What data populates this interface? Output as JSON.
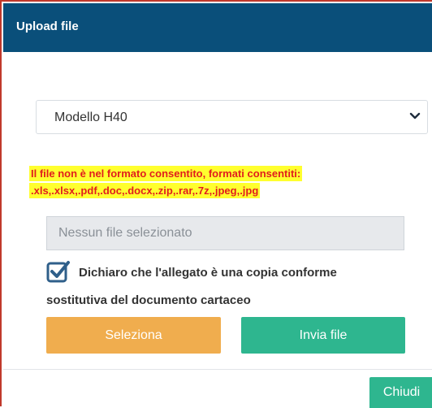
{
  "dialog": {
    "title": "Upload file"
  },
  "document_type": {
    "selected": "Modello H40"
  },
  "error": {
    "line1": "Il file non è nel formato consentito, formati consentiti:",
    "line2": ".xls,.xlsx,.pdf,.doc,.docx,.zip,.rar,.7z,.jpeg,.jpg"
  },
  "file_input": {
    "placeholder": "Nessun file selezionato"
  },
  "declaration": {
    "checked": true,
    "line1": "Dichiaro che l'allegato è una copia conforme",
    "line2": "sostitutiva del documento cartaceo"
  },
  "buttons": {
    "select": "Seleziona",
    "send": "Invia file",
    "close": "Chiudi"
  },
  "colors": {
    "header": "#0a4f7a",
    "error_text": "#e11d1d",
    "error_highlight": "#ffff2e",
    "select_button": "#f0ad4e",
    "primary_button": "#2eb68f",
    "checkbox": "#2f5f8a"
  },
  "icons": {
    "dropdown": "chevron-down-icon",
    "checkbox": "checkbox-checked-icon"
  }
}
